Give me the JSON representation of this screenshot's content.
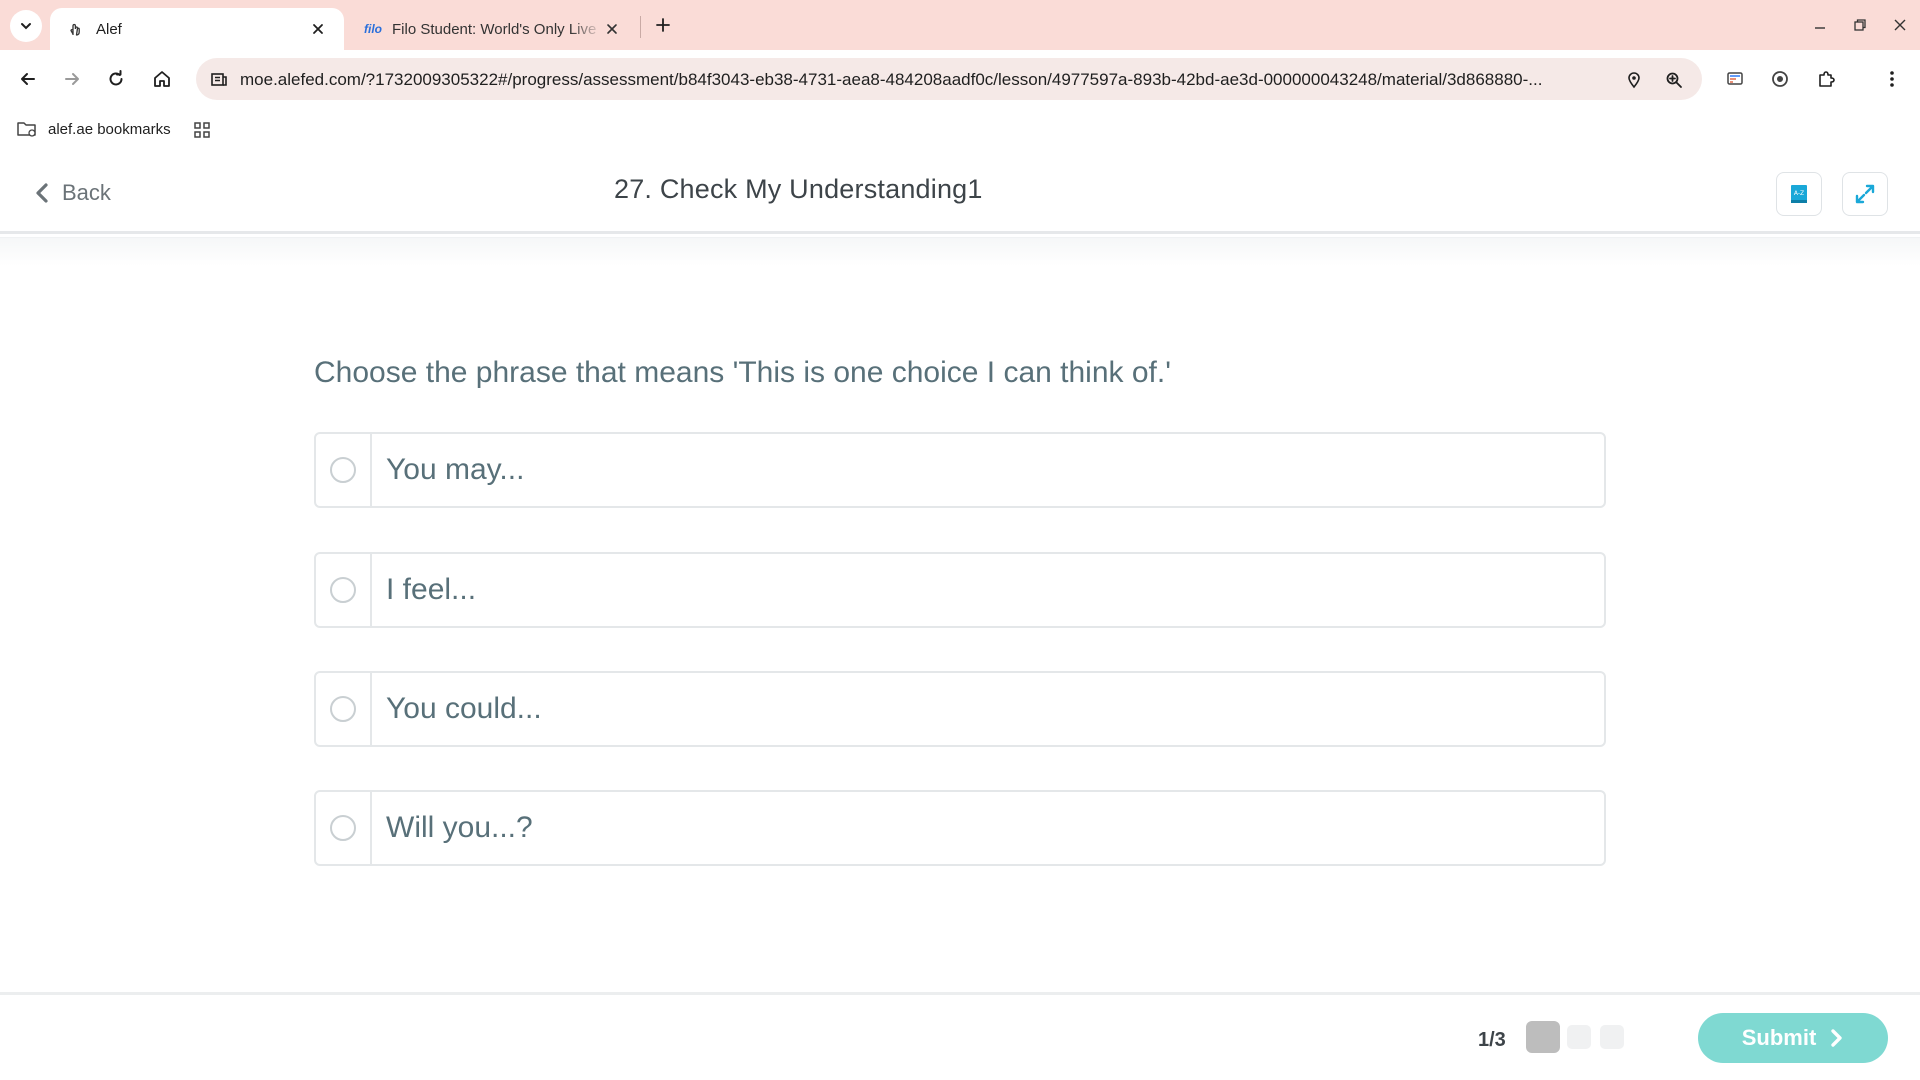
{
  "browser": {
    "tabs": [
      {
        "title": "Alef",
        "favicon": "hand-pointer-icon",
        "active": true
      },
      {
        "title": "Filo Student: World's Only Live Instant Tutoring",
        "favicon_text": "filo",
        "active": false
      }
    ],
    "url": "moe.alefed.com/?1732009305322#/progress/assessment/b84f3043-eb38-4731-aea8-484208aadf0c/lesson/4977597a-893b-42bd-ae3d-000000043248/material/3d868880-...",
    "bookmarks": [
      {
        "label": "alef.ae bookmarks",
        "icon": "folder-icon"
      }
    ]
  },
  "header": {
    "back_label": "Back",
    "lesson_title": "27. Check My Understanding1",
    "dictionary_icon_text": "A-Z"
  },
  "question": {
    "prompt": "Choose the phrase that means 'This is one choice I can think of.'",
    "options": [
      {
        "label": "You may..."
      },
      {
        "label": "I feel..."
      },
      {
        "label": "You could..."
      },
      {
        "label": "Will you...?"
      }
    ]
  },
  "footer": {
    "progress": "1/3",
    "current_step": 1,
    "total_steps": 3,
    "submit_label": "Submit"
  },
  "colors": {
    "tabbar_bg": "#fadcd7",
    "accent_teal": "#7fd9d2",
    "icon_blue": "#1aa8d8",
    "text_slate": "#587079"
  }
}
